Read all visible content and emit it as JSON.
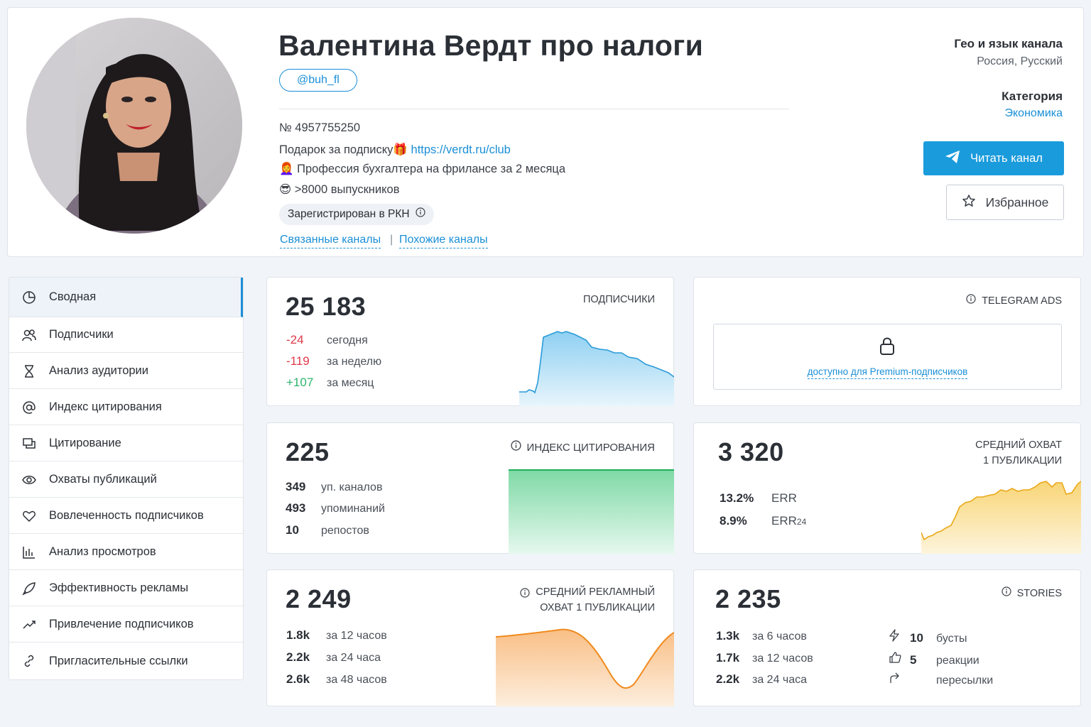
{
  "channel": {
    "title": "Валентина Вердт про налоги",
    "handle": "@buh_fl",
    "number": "№ 4957755250",
    "desc1_prefix": "Подарок за подписку🎁 ",
    "desc1_link": "https://verdt.ru/club",
    "desc2": "👩‍🦰 Профессия бухгалтера на фрилансе за 2 месяца",
    "desc3": "😎 >8000 выпускников",
    "rkn": "Зарегистрирован в РКН",
    "related": "Связанные каналы",
    "separator": "|",
    "similar": "Похожие каналы"
  },
  "meta": {
    "geo_label": "Гео и язык канала",
    "geo_value": "Россия, Русский",
    "category_label": "Категория",
    "category_value": "Экономика"
  },
  "buttons": {
    "read": "Читать канал",
    "favorite": "Избранное"
  },
  "sidebar": {
    "items": [
      {
        "label": "Сводная",
        "icon": "pie-icon"
      },
      {
        "label": "Подписчики",
        "icon": "users-icon"
      },
      {
        "label": "Анализ аудитории",
        "icon": "hourglass-icon"
      },
      {
        "label": "Индекс цитирования",
        "icon": "at-icon"
      },
      {
        "label": "Цитирование",
        "icon": "quote-icon"
      },
      {
        "label": "Охваты публикаций",
        "icon": "eye-icon"
      },
      {
        "label": "Вовлеченность подписчиков",
        "icon": "heart-icon"
      },
      {
        "label": "Анализ просмотров",
        "icon": "bar-chart-icon"
      },
      {
        "label": "Эффективность рекламы",
        "icon": "rocket-icon"
      },
      {
        "label": "Привлечение подписчиков",
        "icon": "trend-icon"
      },
      {
        "label": "Пригласительные ссылки",
        "icon": "link-icon"
      }
    ]
  },
  "subscribers": {
    "value": "25 183",
    "label": "ПОДПИСЧИКИ",
    "rows": [
      {
        "v": "-24",
        "t": "сегодня"
      },
      {
        "v": "-119",
        "t": "за неделю"
      },
      {
        "v": "+107",
        "t": "за месяц"
      }
    ]
  },
  "ads": {
    "label": "TELEGRAM ADS",
    "locked_text": "доступно для Premium-подписчиков"
  },
  "citation": {
    "value": "225",
    "label": "ИНДЕКС ЦИТИРОВАНИЯ",
    "rows": [
      {
        "v": "349",
        "t": "уп. каналов"
      },
      {
        "v": "493",
        "t": "упоминаний"
      },
      {
        "v": "10",
        "t": "репостов"
      }
    ]
  },
  "reach": {
    "value": "3 320",
    "label1": "СРЕДНИЙ ОХВАТ",
    "label2": "1 ПУБЛИКАЦИИ",
    "rows": [
      {
        "v": "13.2%",
        "t": "ERR"
      },
      {
        "v": "8.9%",
        "t": "ERR",
        "sub": "24"
      }
    ]
  },
  "adreach": {
    "value": "2 249",
    "label1": "СРЕДНИЙ РЕКЛАМНЫЙ",
    "label2": "ОХВАТ 1 ПУБЛИКАЦИИ",
    "rows": [
      {
        "v": "1.8k",
        "t": "за 12 часов"
      },
      {
        "v": "2.2k",
        "t": "за 24 часа"
      },
      {
        "v": "2.6k",
        "t": "за 48 часов"
      }
    ]
  },
  "stories": {
    "value": "2 235",
    "label": "STORIES",
    "rows": [
      {
        "v": "1.3k",
        "t": "за 6 часов"
      },
      {
        "v": "1.7k",
        "t": "за 12 часов"
      },
      {
        "v": "2.2k",
        "t": "за 24 часа"
      }
    ],
    "extras": [
      {
        "v": "10",
        "t": "бусты",
        "icon": "bolt-icon"
      },
      {
        "v": "5",
        "t": "реакции",
        "icon": "thumb-icon"
      },
      {
        "v": "",
        "t": "пересылки",
        "icon": "forward-icon"
      }
    ]
  },
  "colors": {
    "accent": "#1a8fd6",
    "negative": "#e0394a",
    "positive": "#2db36b",
    "sub_chart": "#5bbbe8",
    "cite_chart": "#3cc27a",
    "reach_chart": "#f5c040",
    "adreach_chart": "#f08a1c"
  }
}
